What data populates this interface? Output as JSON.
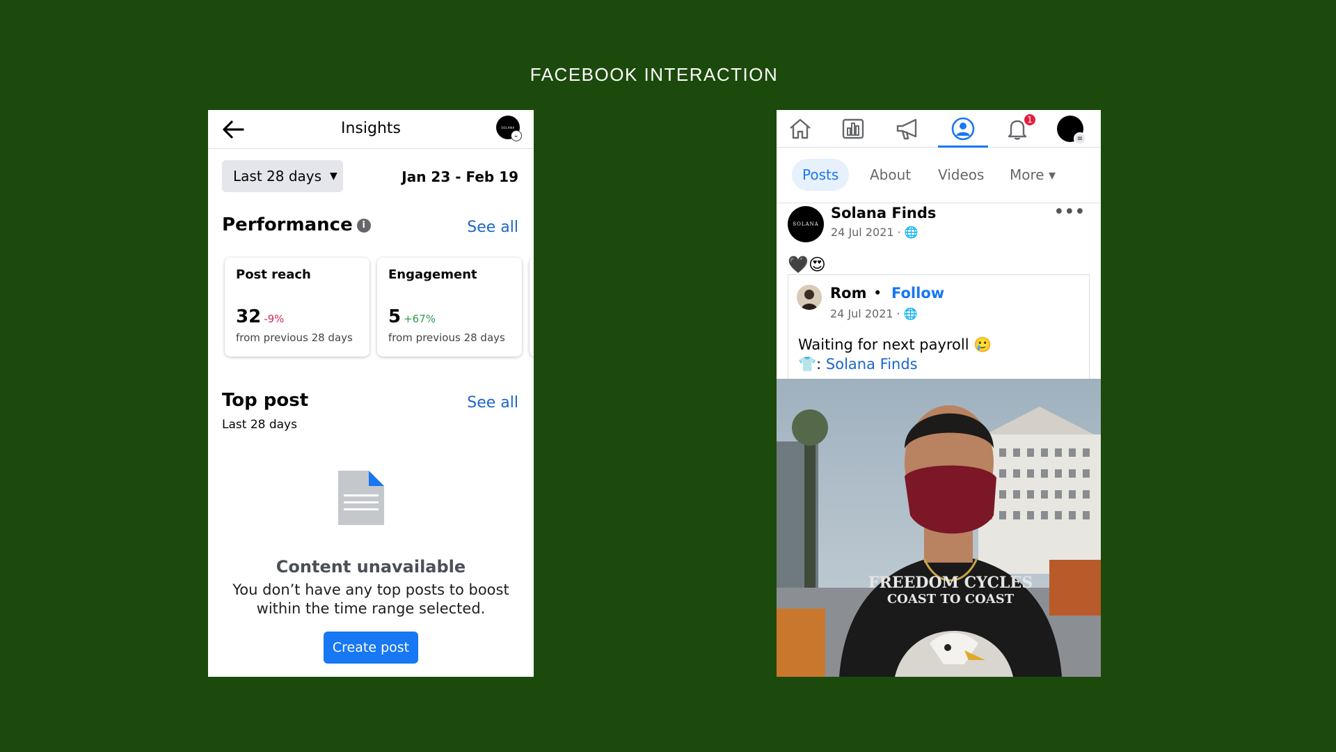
{
  "slide_title": "FACEBOOK INTERACTION",
  "insights": {
    "title": "Insights",
    "avatar_text": "SOLANA",
    "range_label": "Last 28 days",
    "date_range": "Jan 23 - Feb 19",
    "performance": {
      "title": "Performance",
      "see_all": "See all",
      "cards": [
        {
          "title": "Post reach",
          "value": "32",
          "delta": "-9%",
          "sub": "from previous 28 days"
        },
        {
          "title": "Engagement",
          "value": "5",
          "delta": "+67%",
          "sub": "from previous 28 days"
        }
      ]
    },
    "top_post": {
      "title": "Top post",
      "subtitle": "Last 28 days",
      "see_all": "See all",
      "empty_title": "Content unavailable",
      "empty_text": "You don’t have any top posts to boost within the time range selected.",
      "create_button": "Create post"
    }
  },
  "page_view": {
    "notification_count": "1",
    "tabs": [
      {
        "label": "Posts"
      },
      {
        "label": "About"
      },
      {
        "label": "Videos"
      },
      {
        "label": "More ▾"
      }
    ],
    "post": {
      "author": "Solana Finds",
      "avatar_text": "SOLANA",
      "meta": "24 Jul 2021 · 🌐",
      "text": "🖤😍",
      "more": "•••",
      "shared": {
        "author": "Rom",
        "separator": "•",
        "follow": "Follow",
        "meta": "24 Jul 2021 · 🌐",
        "caption_line1": "Waiting for next payroll 🥲",
        "caption_prefix": "👕: ",
        "caption_link": "Solana Finds"
      },
      "photo_shirt_text_1": "FREEDOM CYCLES",
      "photo_shirt_text_2": "COAST TO COAST"
    }
  },
  "colors": {
    "background": "#1c4a0c",
    "facebook_blue": "#1877f2",
    "negative": "#d0284b",
    "positive": "#2f9a48"
  }
}
